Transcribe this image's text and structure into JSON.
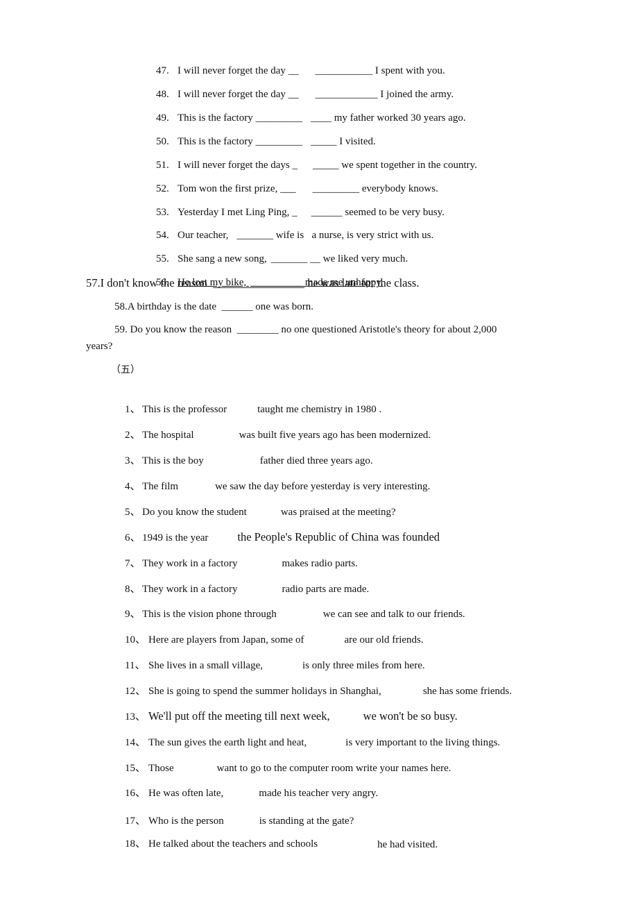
{
  "part_a": {
    "items": [
      {
        "num": "47.",
        "before": "I will never forget the day __",
        "after": "___________ I spent with you."
      },
      {
        "num": "48.",
        "before": "I will never forget the day __",
        "after": "____________ I joined the army."
      },
      {
        "num": "49.",
        "before": "This is the factory _________",
        "after": "____ my father worked 30 years ago."
      },
      {
        "num": "50.",
        "before": "This is the factory _________",
        "after": "_____ I visited."
      },
      {
        "num": "51.",
        "before": "I will never forget the days _",
        "after": "_____ we spent together in the country."
      },
      {
        "num": "52.",
        "before": "Tom won the first prize, ___",
        "after": "_________ everybody knows."
      },
      {
        "num": "53.",
        "before": "Yesterday I met Ling Ping, _",
        "after": "______ seemed to be very busy."
      },
      {
        "num": "54.",
        "before": "Our teacher,",
        "after": "_______ wife is   a nurse, is very strict with us."
      },
      {
        "num": "55.",
        "before": "She sang a new song,",
        "after": "_______ __ we liked very much."
      },
      {
        "num": "56.",
        "before": "He lost my bike,",
        "after": "__________ made me unhappy."
      }
    ],
    "item_57": "57.I don't know the reason  ________________ he was late for the class.",
    "item_58": "58.A birthday is the date  ______ one was born.",
    "item_59_line1": "59. Do you know the reason  ________ no one questioned Aristotle's theory for about 2,000",
    "item_59_line2": "years?"
  },
  "section_heading": "（五）",
  "part_b": {
    "items": [
      {
        "num": "1、",
        "before": "This is the professor",
        "after": "taught me chemistry in 1980 ."
      },
      {
        "num": "2、",
        "before": "The hospital",
        "after": "was built five years ago has been modernized."
      },
      {
        "num": "3、",
        "before": "This is the boy",
        "after": "father died three years ago."
      },
      {
        "num": "4、",
        "before": "The film",
        "after": "we saw the day before yesterday is very interesting."
      },
      {
        "num": "5、",
        "before": "Do you know the student",
        "after": "was praised at the meeting?"
      },
      {
        "num": "6、",
        "before": "1949 is the year",
        "after": "the People's Republic of China was founded"
      },
      {
        "num": "7、",
        "before": "They work in a factory",
        "after": "makes radio parts."
      },
      {
        "num": "8、",
        "before": "They work in a factory",
        "after": "radio parts are made."
      },
      {
        "num": "9、",
        "before": "This is the vision phone through",
        "after": "we can see and talk to our friends."
      },
      {
        "num": "10、",
        "before": "Here are players from Japan, some of",
        "after": "are our old friends."
      },
      {
        "num": "11、",
        "before": "She lives in a small village,",
        "after": "is only three miles from here."
      },
      {
        "num": "12、",
        "before": "She is going to spend the summer holidays in Shanghai,",
        "after": "she has some friends."
      },
      {
        "num": "13、",
        "before": "We'll put off the meeting till next week,",
        "after": "we won't be so busy."
      },
      {
        "num": "14、",
        "before": "The sun gives the earth light and heat,",
        "after": "is very important to the living things."
      },
      {
        "num": "15、",
        "before": "Those",
        "after": "want to go to the computer room write your names here."
      },
      {
        "num": "16、",
        "before": "He was often late,",
        "after": "made his teacher very angry."
      },
      {
        "num": "17、",
        "before": "Who is the person",
        "after": "is standing at the gate?"
      },
      {
        "num": "18、",
        "before": "He talked about the teachers and schools",
        "after": "he had visited."
      }
    ]
  }
}
